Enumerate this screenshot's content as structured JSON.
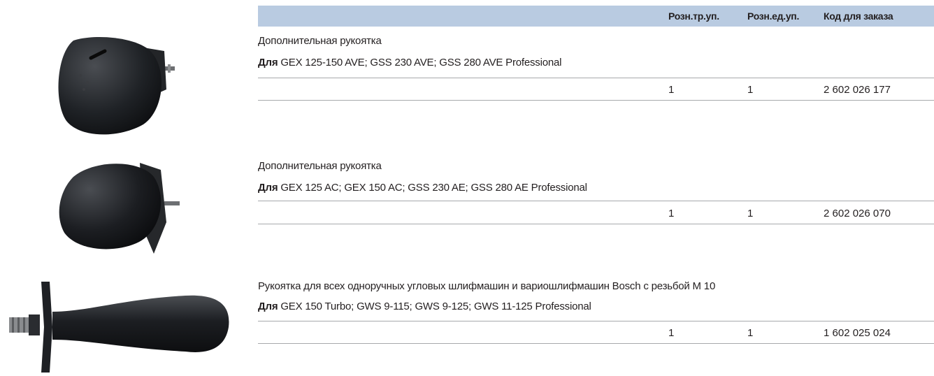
{
  "table_header": {
    "col_retail_pack": "Розн.тр.уп.",
    "col_retail_unit": "Розн.ед.уп.",
    "col_order_code": "Код для заказа"
  },
  "for_label": "Для",
  "products": [
    {
      "title": "Дополнительная рукоятка",
      "compatibility": "GEX 125-150 AVE; GSS 230 AVE; GSS 280 AVE Professional",
      "retail_pack": "1",
      "retail_unit": "1",
      "order_code": "2 602 026 177",
      "image_icon": "ergonomic-handle-icon"
    },
    {
      "title": "Дополнительная рукоятка",
      "compatibility": "GEX 125 AC; GEX 150 AC; GSS 230 AE; GSS 280 AE Professional",
      "retail_pack": "1",
      "retail_unit": "1",
      "order_code": "2 602 026 070",
      "image_icon": "ergonomic-handle-icon"
    },
    {
      "title": "Рукоятка для всех одноручных угловых шлифмашин и вариошлифмашин Bosch с резьбой M 10",
      "compatibility": "GEX 150 Turbo; GWS 9-115; GWS 9-125; GWS 11-125 Professional",
      "retail_pack": "1",
      "retail_unit": "1",
      "order_code": "1 602 025 024",
      "image_icon": "side-handle-icon"
    }
  ],
  "colors": {
    "header_bg": "#b9cbe1",
    "rule": "#a7a9ac",
    "text": "#231f20"
  }
}
